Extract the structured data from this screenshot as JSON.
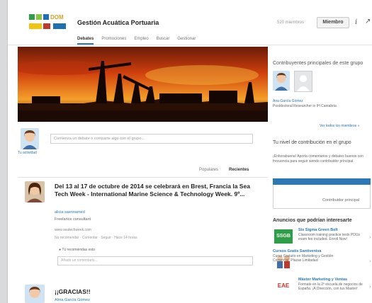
{
  "header": {
    "logo_text_top": "DOM",
    "group_title": "Gestión Acuática Portuaria",
    "members_count": "520 miembros",
    "member_button": "Miembro",
    "info_icon": "i",
    "share_icon": "↗"
  },
  "tabs": [
    {
      "label": "Debates",
      "active": true
    },
    {
      "label": "Promociones",
      "active": false
    },
    {
      "label": "Empleo",
      "active": false
    },
    {
      "label": "Buscar",
      "active": false
    },
    {
      "label": "Gestionar",
      "active": false
    }
  ],
  "composer": {
    "avatar_label": "Tu actividad",
    "placeholder": "Comienza un debate o comparte algo con el grupo..."
  },
  "sort": {
    "popular": "Populares",
    "recent": "Recientes"
  },
  "post1": {
    "title": "Del 13 al 17 de octubre de 2014 se celebrará en Brest, Francia la Sea Tech Week - International Marine Science & Technology Week. 9º...",
    "author": "alicia saennamed",
    "author_role": "Freelance consultant",
    "link": "www.seatechweek.com",
    "actions": "No recomendar · Comentar · Seguir · Hace 14 horas",
    "likes": "Tú recomiendas esto",
    "comment_placeholder": "Añadir un comentario..."
  },
  "post2": {
    "title": "¡¡GRACIAS!!",
    "author": "Alma García Gómez"
  },
  "sidebar": {
    "top_contributors_title": "Contribuyentes principales de este grupo",
    "contributor_name": "Ana García Gómez",
    "contributor_role": "Postdoctoral Researcher in IH Cantabria",
    "see_all": "Ver todos los miembros »",
    "contribution_title": "Tu nivel de contribución en el grupo",
    "contribution_text": "¡Enhorabuena! Aporta comentarios y debates buenos con frecuencia para seguir siendo contribuidor principal",
    "contribution_level": "Contribuidor principal",
    "ads_title": "Anuncios que podrían interesarte",
    "ads": [
      {
        "logo": "SSGB",
        "color": "#2e9e48",
        "title": "Six Sigma Green Belt",
        "text": "Classroom training practice tests PDUs exam fee included. Enroll Now!"
      },
      {
        "logo": "",
        "color": "#ffffff",
        "title": "Cursos Gratis Santiveniva",
        "text": "Curso Gratuito en Marketing y Gestión Comercial. Plazas Limitadas!"
      },
      {
        "logo": "EAE",
        "color": "#ffffff",
        "title": "Máster Marketing y Ventas",
        "text": "Formate en la 2ª escuela de negocios de España. ¡A Dirección, con tus Master!"
      }
    ]
  }
}
